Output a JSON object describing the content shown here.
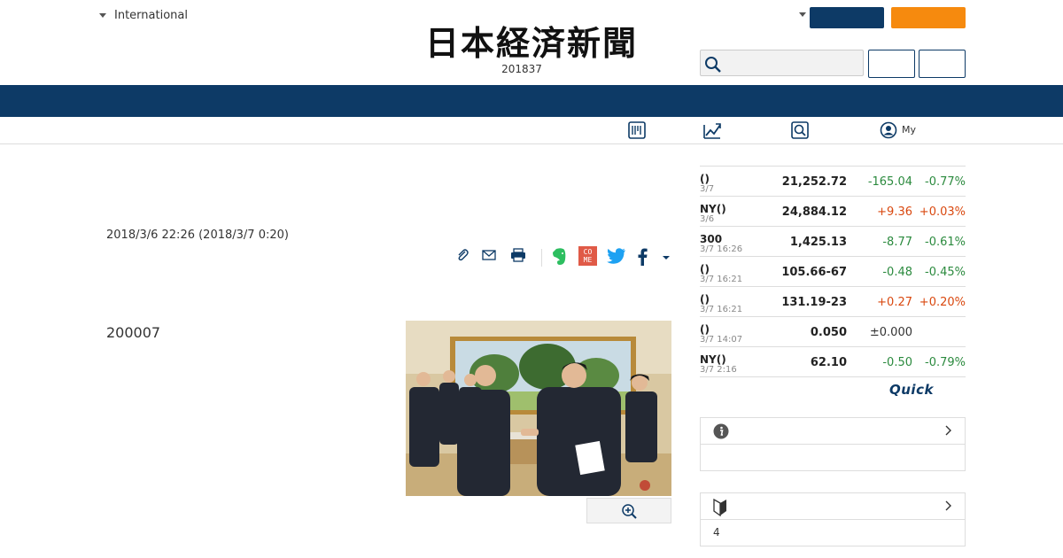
{
  "header": {
    "edition_label": "International",
    "logo_text": "日本経済新聞",
    "date_text": "201837",
    "search": {
      "placeholder": ""
    },
    "colors": {
      "navy": "#0d3a66",
      "orange": "#f68a0e"
    }
  },
  "subnav": {
    "icons": [
      "newspaper-icon",
      "chart-icon",
      "search-box-icon",
      "user-circle-icon"
    ],
    "my_label": "My"
  },
  "article": {
    "date": "2018/3/6 22:26 (2018/3/7 0:20)",
    "lead": "200007",
    "tools": [
      "clip-icon",
      "mail-icon",
      "print-icon",
      "evernote-icon",
      "comemo-icon",
      "twitter-icon",
      "facebook-icon",
      "more-dropdown-icon"
    ],
    "comemo_text": "COME"
  },
  "market": {
    "rows": [
      {
        "name": "()",
        "time": "3/7",
        "value": "21,252.72",
        "change": "-165.04",
        "pct": "-0.77%",
        "dir": "neg"
      },
      {
        "name": "NY()",
        "time": "3/6",
        "value": "24,884.12",
        "change": "+9.36",
        "pct": "+0.03%",
        "dir": "pos"
      },
      {
        "name": "300",
        "time": "3/7 16:26",
        "value": "1,425.13",
        "change": "-8.77",
        "pct": "-0.61%",
        "dir": "neg"
      },
      {
        "name": "()",
        "time": "3/7 16:21",
        "value": "105.66-67",
        "change": "-0.48",
        "pct": "-0.45%",
        "dir": "neg"
      },
      {
        "name": "()",
        "time": "3/7 16:21",
        "value": "131.19-23",
        "change": "+0.27",
        "pct": "+0.20%",
        "dir": "pos"
      },
      {
        "name": "()",
        "time": "3/7 14:07",
        "value": "0.050",
        "change": "±0.000",
        "pct": "",
        "dir": "neu"
      },
      {
        "name": "NY()",
        "time": "3/7 2:16",
        "value": "62.10",
        "change": "-0.50",
        "pct": "-0.79%",
        "dir": "neg"
      }
    ],
    "brand": "Quick"
  },
  "boxes": {
    "info": {
      "body": ""
    },
    "beginner": {
      "body": "4"
    }
  }
}
